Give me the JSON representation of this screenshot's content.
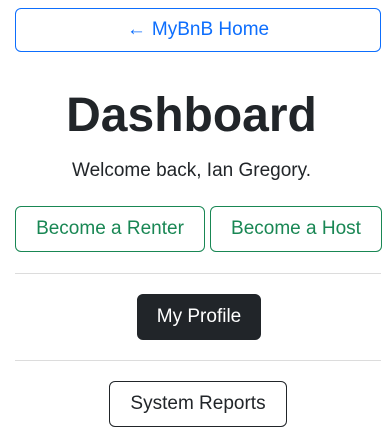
{
  "nav": {
    "home_arrow": "←",
    "home_label": "MyBnB Home"
  },
  "header": {
    "title": "Dashboard",
    "welcome": "Welcome back, Ian Gregory."
  },
  "actions": {
    "renter_label": "Become a Renter",
    "host_label": "Become a Host",
    "profile_label": "My Profile",
    "reports_label": "System Reports"
  },
  "colors": {
    "primary": "#0d6efd",
    "success": "#198754",
    "dark": "#212529"
  }
}
